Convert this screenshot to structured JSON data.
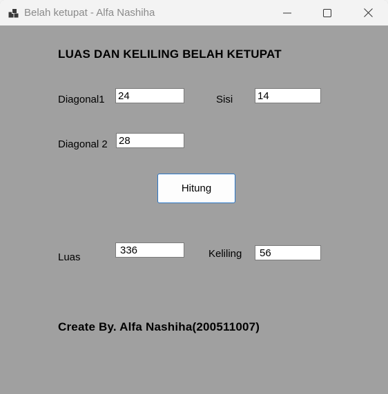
{
  "window": {
    "title": "Belah ketupat - Alfa Nashiha",
    "icon": "app-window-icon"
  },
  "form": {
    "heading": "LUAS DAN KELILING BELAH KETUPAT",
    "diagonal1": {
      "label": "Diagonal1",
      "value": "24"
    },
    "sisi": {
      "label": "Sisi",
      "value": "14"
    },
    "diagonal2": {
      "label": "Diagonal 2",
      "value": "28"
    },
    "hitung_label": "Hitung",
    "luas": {
      "label": "Luas",
      "value": "336"
    },
    "keliling": {
      "label": "Keliling",
      "value": "56"
    },
    "footer": "Create By. Alfa Nashiha(200511007)"
  },
  "colors": {
    "client_background": "#a0a0a0",
    "titlebar_background": "#f3f3f3",
    "button_border": "#2a76c6"
  }
}
